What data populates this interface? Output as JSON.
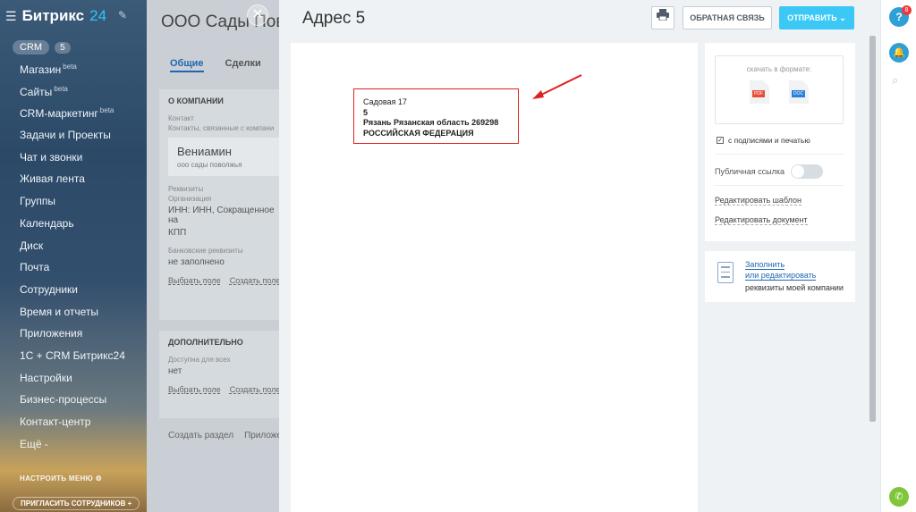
{
  "sidebar": {
    "logo_text": "Битрикс",
    "logo_num": "24",
    "crm_label": "CRM",
    "crm_count": "5",
    "items": [
      {
        "label": "Магазин",
        "sup": "beta"
      },
      {
        "label": "Сайты",
        "sup": "beta"
      },
      {
        "label": "CRM-маркетинг",
        "sup": "beta"
      },
      {
        "label": "Задачи и Проекты",
        "sup": ""
      },
      {
        "label": "Чат и звонки",
        "sup": ""
      },
      {
        "label": "Живая лента",
        "sup": ""
      },
      {
        "label": "Группы",
        "sup": ""
      },
      {
        "label": "Календарь",
        "sup": ""
      },
      {
        "label": "Диск",
        "sup": ""
      },
      {
        "label": "Почта",
        "sup": ""
      },
      {
        "label": "Сотрудники",
        "sup": ""
      },
      {
        "label": "Время и отчеты",
        "sup": ""
      },
      {
        "label": "Приложения",
        "sup": ""
      },
      {
        "label": "1С + CRM Битрикс24",
        "sup": ""
      },
      {
        "label": "Настройки",
        "sup": ""
      },
      {
        "label": "Бизнес-процессы",
        "sup": ""
      },
      {
        "label": "Контакт-центр",
        "sup": ""
      },
      {
        "label": "Ещё -",
        "sup": ""
      }
    ],
    "setup_menu": "НАСТРОИТЬ МЕНЮ",
    "invite": "ПРИГЛАСИТЬ СОТРУДНИКОВ"
  },
  "crm": {
    "title": "ООО Сады Пово",
    "tabs": [
      "Общие",
      "Сделки",
      "Т"
    ],
    "company_header": "О КОМПАНИИ",
    "contact_label": "Контакт",
    "contact_sub": "Контакты, связанные с компани",
    "contact_name": "Вениамин",
    "contact_company": "ооо сады поволжья",
    "req_label": "Реквизиты",
    "org_label": "Организация",
    "org_value": "ИНН: ИНН, Сокращенное на",
    "kpp": "КПП",
    "bank_label": "Банковские реквизиты",
    "bank_value": "не заполнено",
    "choose_field": "Выбрать поле",
    "create_field": "Создать поле",
    "extra_header": "ДОПОЛНИТЕЛЬНО",
    "avail_label": "Доступна для всех",
    "avail_value": "нет",
    "create_section": "Создать раздел",
    "apps": "Приложен"
  },
  "slider": {
    "title": "Адрес 5",
    "feedback_button": "ОБРАТНАЯ СВЯЗЬ",
    "send_button": "ОТПРАВИТЬ",
    "address_lines": [
      "Садовая 17",
      "5",
      "Рязань Рязанская область 269298",
      "РОССИЙСКАЯ ФЕДЕРАЦИЯ"
    ],
    "download_label": "скачать в формате:",
    "pdf": "PDF",
    "doc": "DOC",
    "signatures_label": "с подписями и печатью",
    "public_link_label": "Публичная ссылка",
    "edit_template": "Редактировать шаблон",
    "edit_document": "Редактировать документ",
    "fill_link1": "Заполнить",
    "fill_link2": "или редактировать",
    "fill_text": "реквизиты моей компании"
  },
  "right_bar": {
    "help": "?",
    "help_badge": "8"
  },
  "colors": {
    "accent": "#3bc8f5",
    "highlight_red": "#e02020",
    "link_blue": "#2067b0"
  }
}
